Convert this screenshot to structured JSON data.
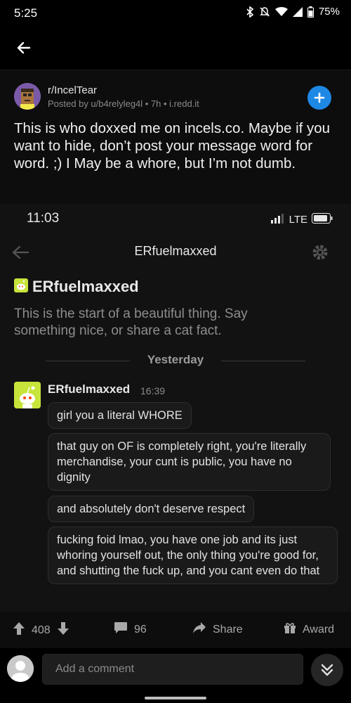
{
  "status_bar": {
    "time": "5:25",
    "battery": "75%"
  },
  "post": {
    "subreddit": "r/IncelTear",
    "meta": "Posted by u/b4relyleg4l • 7h • i.redd.it",
    "title": "This is who doxxed me on incels.co. Maybe if you want to hide, don’t post your message word for word. ;) I May be a whore, but I’m not dumb."
  },
  "embedded": {
    "time": "11:03",
    "network": "LTE",
    "chat_title": "ERfuelmaxxed",
    "chat_name": "ERfuelmaxxed",
    "intro": "This is the start of a beautiful thing. Say something nice, or share a cat fact.",
    "divider": "Yesterday",
    "sender": "ERfuelmaxxed",
    "timestamp": "16:39",
    "messages": [
      "girl you a literal WHORE",
      "that guy on OF is completely right, you're literally merchandise, your cunt is public, you have no dignity",
      "and absolutely don't deserve respect",
      "fucking foid lmao, you have one job and its just whoring yourself out, the only thing you're good for, and shutting the fuck up, and you cant even do that"
    ]
  },
  "actions": {
    "upvotes": "408",
    "comments": "96",
    "share": "Share",
    "award": "Award"
  },
  "comment_bar": {
    "placeholder": "Add a comment"
  },
  "colors": {
    "background": "#000000",
    "accent": "#1e88e5",
    "avatar": "#c6e43a"
  }
}
